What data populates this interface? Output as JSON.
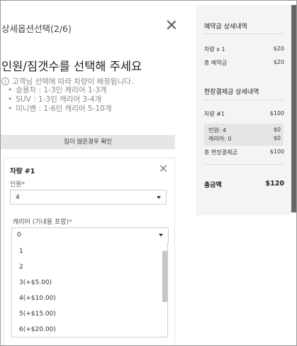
{
  "modal": {
    "title": "상세옵션선택(2/6)",
    "heading": "인원/짐갯수를 선택해 주세요",
    "info_text": "고객님 선택에 따라 차량이 배정됩니다.",
    "info_icon": "i",
    "bullets": [
      "승용차 : 1-3인 캐리어 1-3개",
      "SUV : 1-3인 캐리어 3-4개",
      "미니밴 : 1-6인 캐리어 5-10개"
    ],
    "check_button": "짐이 많은경우 확인"
  },
  "card": {
    "title": "차량 #1",
    "people_label": "인원",
    "people_value": "4",
    "carrier_label": "캐리어 (기내용 포함)",
    "carrier_value": "0",
    "required_mark": "*",
    "carrier_options": [
      "1",
      "2",
      "3(+$5.00)",
      "4(+$10.00)",
      "5(+$15.00)",
      "6(+$20.00)"
    ]
  },
  "summary": {
    "deposit_title": "예약금 상세내역",
    "deposit_rows": [
      {
        "label": "차량 x 1",
        "amount": "$20"
      },
      {
        "label": "총 예약금",
        "amount": "$20"
      }
    ],
    "onsite_title": "현장결제금 상세내역",
    "vehicle_label": "차량 #1",
    "vehicle_amount": "$100",
    "sub_rows": [
      {
        "label": "인원: 4",
        "amount": "$0"
      },
      {
        "label": "캐리어: 0",
        "amount": "$0"
      }
    ],
    "onsite_total_label": "총 현장결제금",
    "onsite_total_amount": "$100",
    "grand_label": "총금액",
    "grand_amount": "$120"
  }
}
